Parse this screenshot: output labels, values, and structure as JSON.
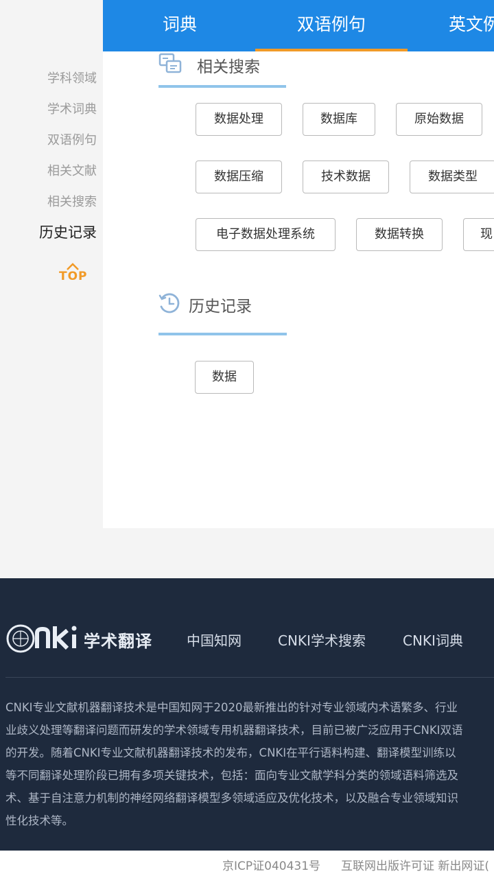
{
  "tabs": {
    "dictionary": "词典",
    "bilingual": "双语例句",
    "english_literature": "英文例"
  },
  "sidenav": {
    "items": [
      "学科领域",
      "学术词典",
      "双语例句",
      "相关文献",
      "相关搜索",
      "历史记录"
    ],
    "top_label": "TOP"
  },
  "related_search": {
    "title": "相关搜索",
    "chips": [
      "数据处理",
      "数据库",
      "原始数据",
      "数据压缩",
      "技术数据",
      "数据类型",
      "电子数据处理系统",
      "数据转换",
      "现"
    ]
  },
  "history": {
    "title": "历史记录",
    "chips": [
      "数据"
    ]
  },
  "footer": {
    "brand": "学术翻译",
    "links": [
      "中国知网",
      "CNKI学术搜索",
      "CNKI词典"
    ],
    "description": "CNKI专业文献机器翻译技术是中国知网于2020最新推出的针对专业领域内术语繁多、行业\n业歧义处理等翻译问题而研发的学术领域专用机器翻译技术，目前已被广泛应用于CNKI双语\n的开发。随着CNKI专业文献机器翻译技术的发布，CNKI在平行语料构建、翻译模型训练以\n等不同翻译处理阶段已拥有多项关键技术，包括：面向专业文献学科分类的领域语料筛选及\n术、基于自注意力机制的神经网络翻译模型多领域适应及优化技术，以及融合专业领域知识\n性化技术等。",
    "icp": "京ICP证040431号",
    "publish_license": "互联网出版许可证 新出网证("
  },
  "colors": {
    "tab_bar": "#1e88e5",
    "tab_indicator": "#f19a27",
    "section_line": "#90c4ea",
    "footer_bg": "#1e2a3d"
  }
}
